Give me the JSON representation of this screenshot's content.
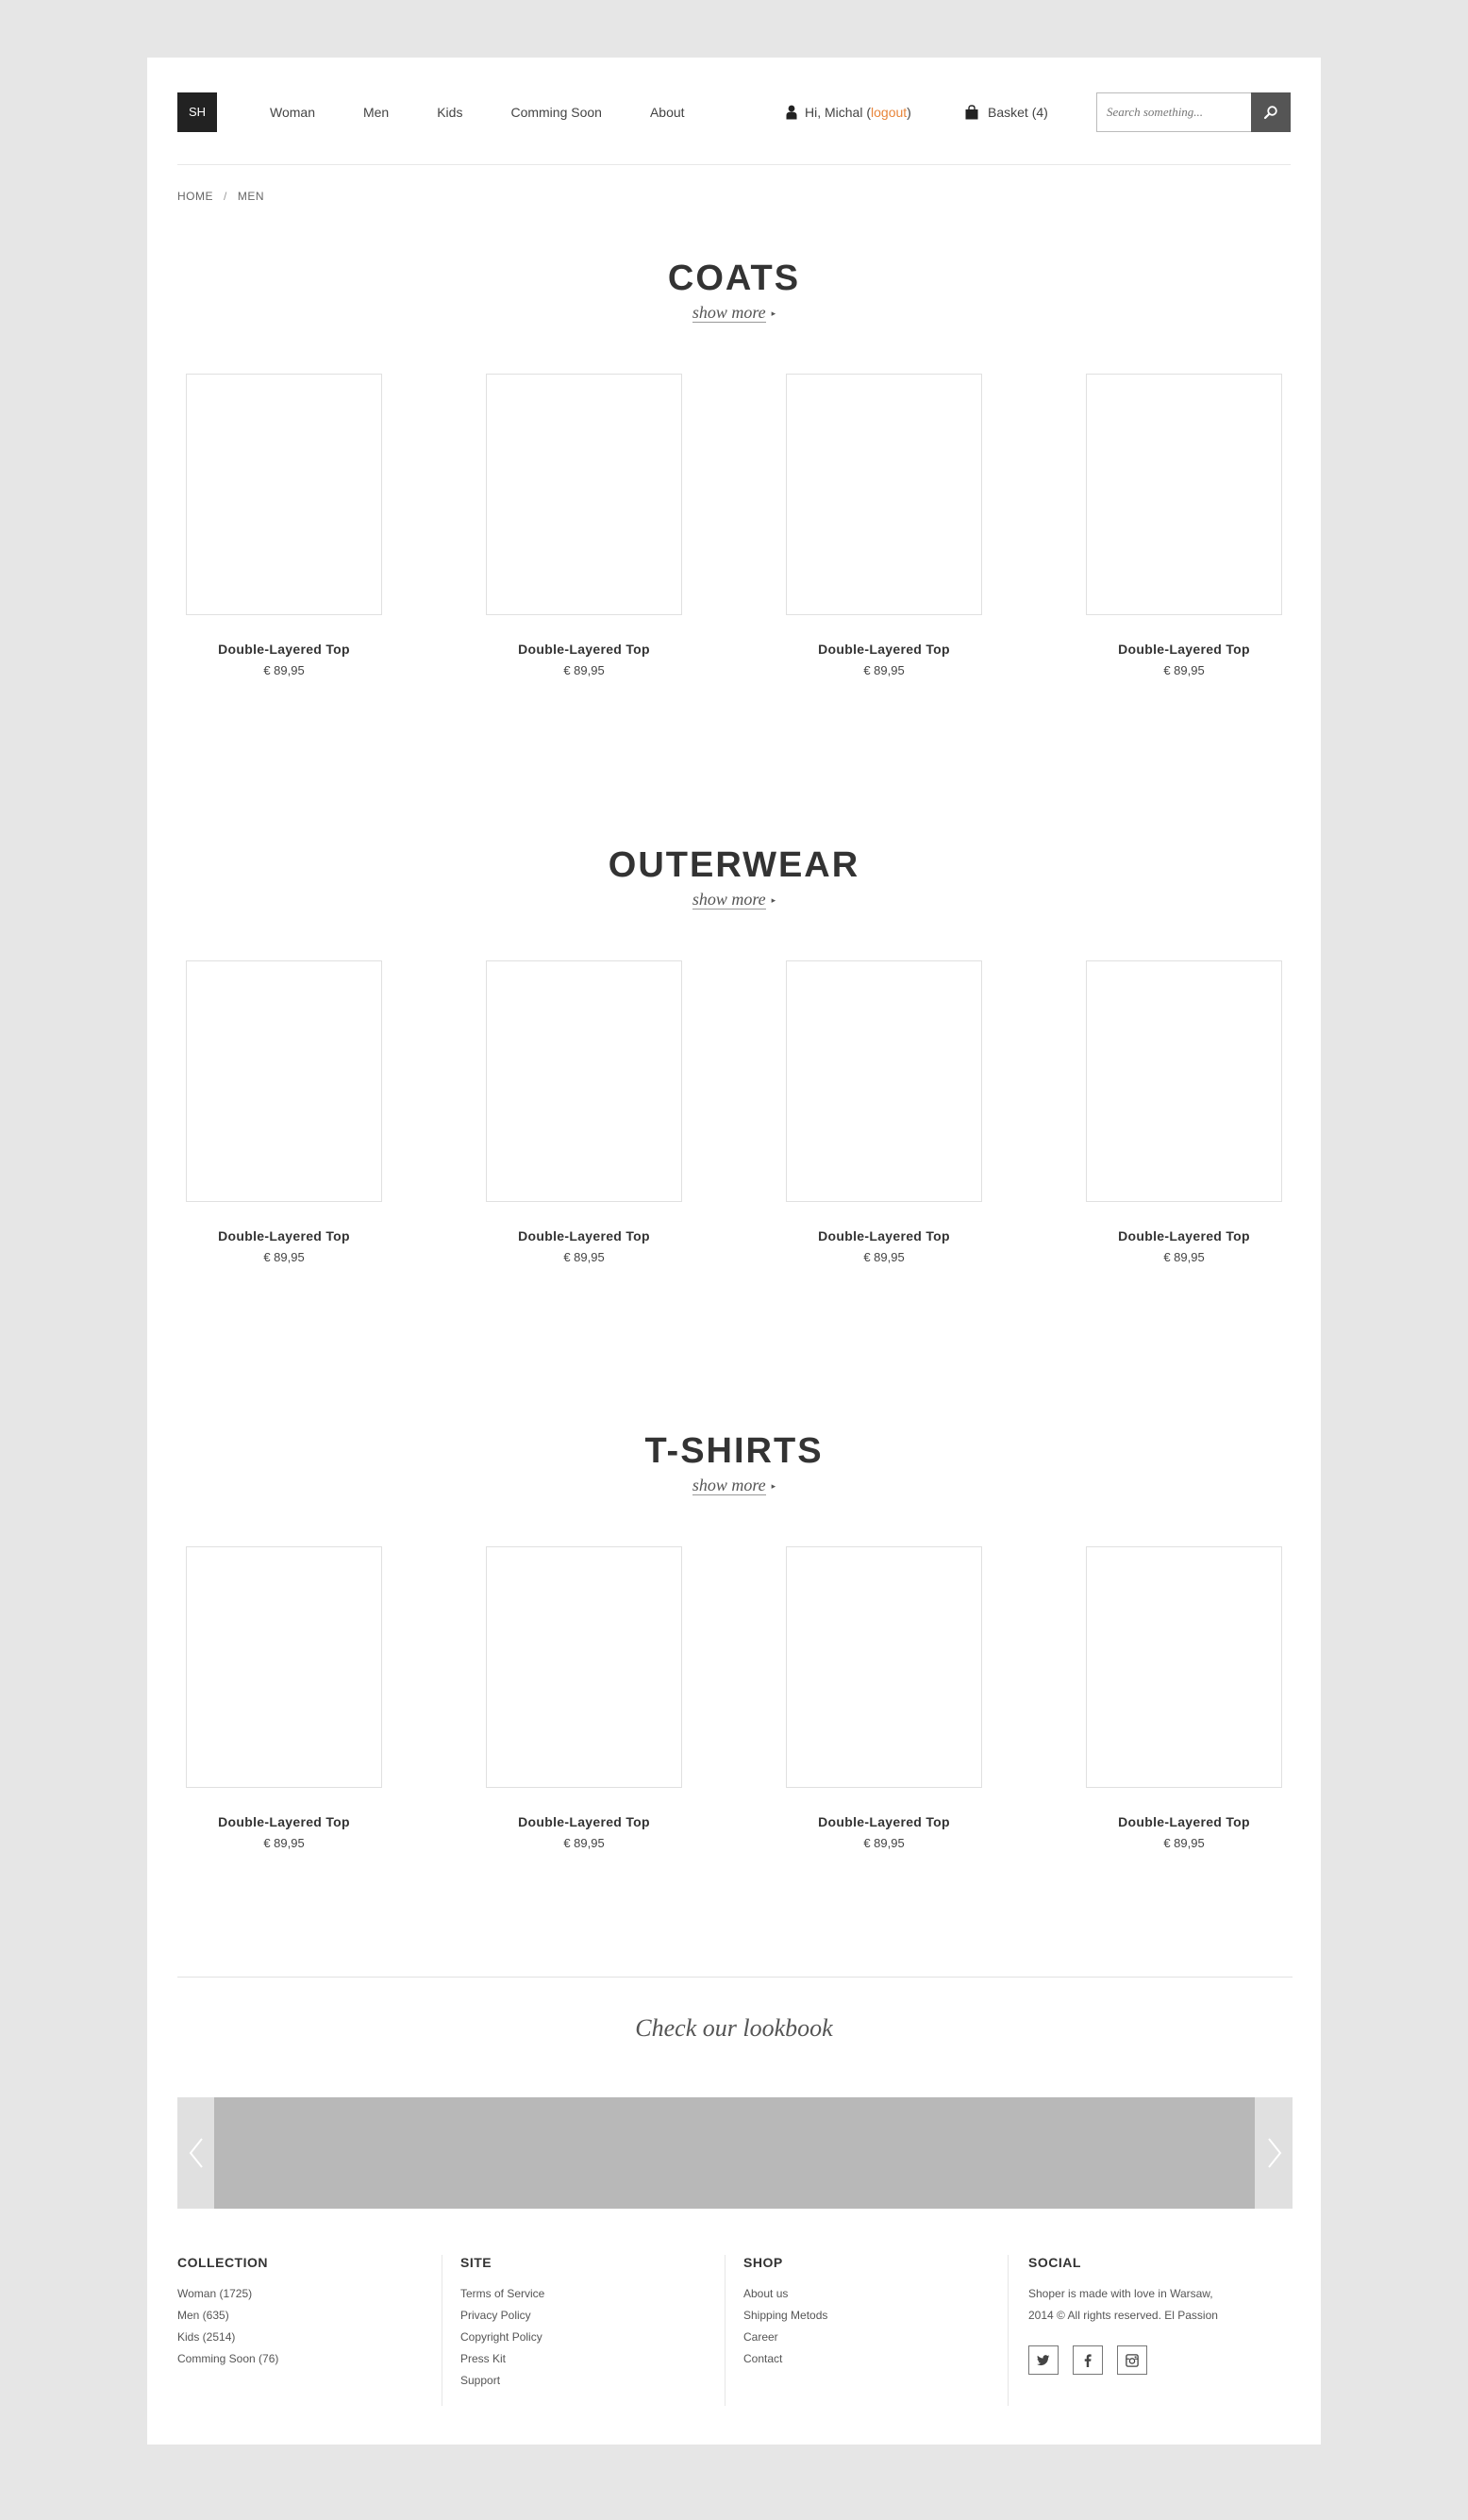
{
  "header": {
    "logo": "SH",
    "nav": [
      "Woman",
      "Men",
      "Kids",
      "Comming Soon",
      "About"
    ],
    "user_greeting": "Hi, Michal (",
    "logout": "logout",
    "user_close": ")",
    "basket": "Basket (4)",
    "search_placeholder": "Search something..."
  },
  "breadcrumb": [
    "HOME",
    "MEN"
  ],
  "breadcrumb_sep": "/",
  "sections": [
    {
      "title": "COATS",
      "show_more": "show more",
      "products": [
        {
          "name": "Double-Layered Top",
          "price": "€ 89,95"
        },
        {
          "name": "Double-Layered Top",
          "price": "€ 89,95"
        },
        {
          "name": "Double-Layered Top",
          "price": "€ 89,95"
        },
        {
          "name": "Double-Layered Top",
          "price": "€ 89,95"
        }
      ]
    },
    {
      "title": "OUTERWEAR",
      "show_more": "show more",
      "products": [
        {
          "name": "Double-Layered Top",
          "price": "€ 89,95"
        },
        {
          "name": "Double-Layered Top",
          "price": "€ 89,95"
        },
        {
          "name": "Double-Layered Top",
          "price": "€ 89,95"
        },
        {
          "name": "Double-Layered Top",
          "price": "€ 89,95"
        }
      ]
    },
    {
      "title": "T-SHIRTS",
      "show_more": "show more",
      "products": [
        {
          "name": "Double-Layered Top",
          "price": "€ 89,95"
        },
        {
          "name": "Double-Layered Top",
          "price": "€ 89,95"
        },
        {
          "name": "Double-Layered Top",
          "price": "€ 89,95"
        },
        {
          "name": "Double-Layered Top",
          "price": "€ 89,95"
        }
      ]
    }
  ],
  "lookbook": {
    "title": "Check our lookbook"
  },
  "footer": {
    "collection": {
      "title": "COLLECTION",
      "items": [
        "Woman (1725)",
        "Men (635)",
        "Kids (2514)",
        "Comming Soon (76)"
      ]
    },
    "site": {
      "title": "SITE",
      "items": [
        "Terms of Service",
        "Privacy Policy",
        "Copyright Policy",
        "Press Kit",
        "Support"
      ]
    },
    "shop": {
      "title": "SHOP",
      "items": [
        "About us",
        "Shipping Metods",
        "Career",
        "Contact"
      ]
    },
    "social": {
      "title": "SOCIAL",
      "text_line1": "Shoper is made with love in Warsaw,",
      "text_line2": "2014 © All rights reserved. El Passion",
      "icons": [
        "twitter-icon",
        "facebook-icon",
        "instagram-icon"
      ]
    }
  },
  "colors": {
    "accent": "#e8853a",
    "background": "#e6e6e6",
    "logo_bg": "#222222",
    "slide": "#b8b8b8"
  }
}
